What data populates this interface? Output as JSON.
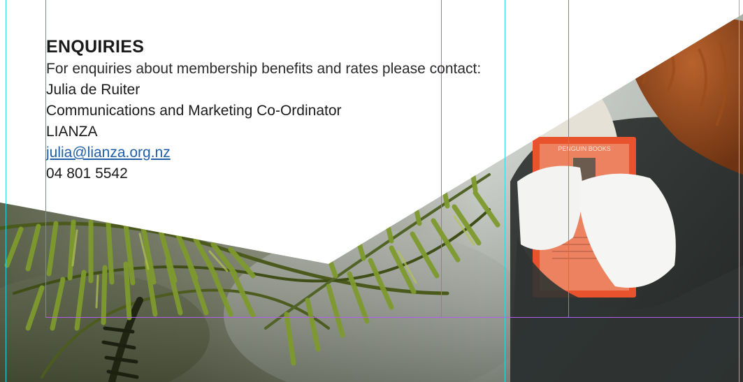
{
  "enquiries": {
    "heading": "ENQUIRIES",
    "intro": "For enquiries about membership benefits and rates please contact:",
    "contact_name": "Julia de Ruiter",
    "contact_title": "Communications and Marketing Co-Ordinator",
    "organisation": "LIANZA",
    "email": "julia@lianza.org.nz",
    "phone": "04 801 5542"
  },
  "book_cover": {
    "title": "PENGUIN BOOKS"
  },
  "colors": {
    "guide_cyan": "#35d7e0",
    "guide_purple": "#b25cf0",
    "link_blue": "#1f5fa8",
    "book_orange": "#e8522d"
  }
}
